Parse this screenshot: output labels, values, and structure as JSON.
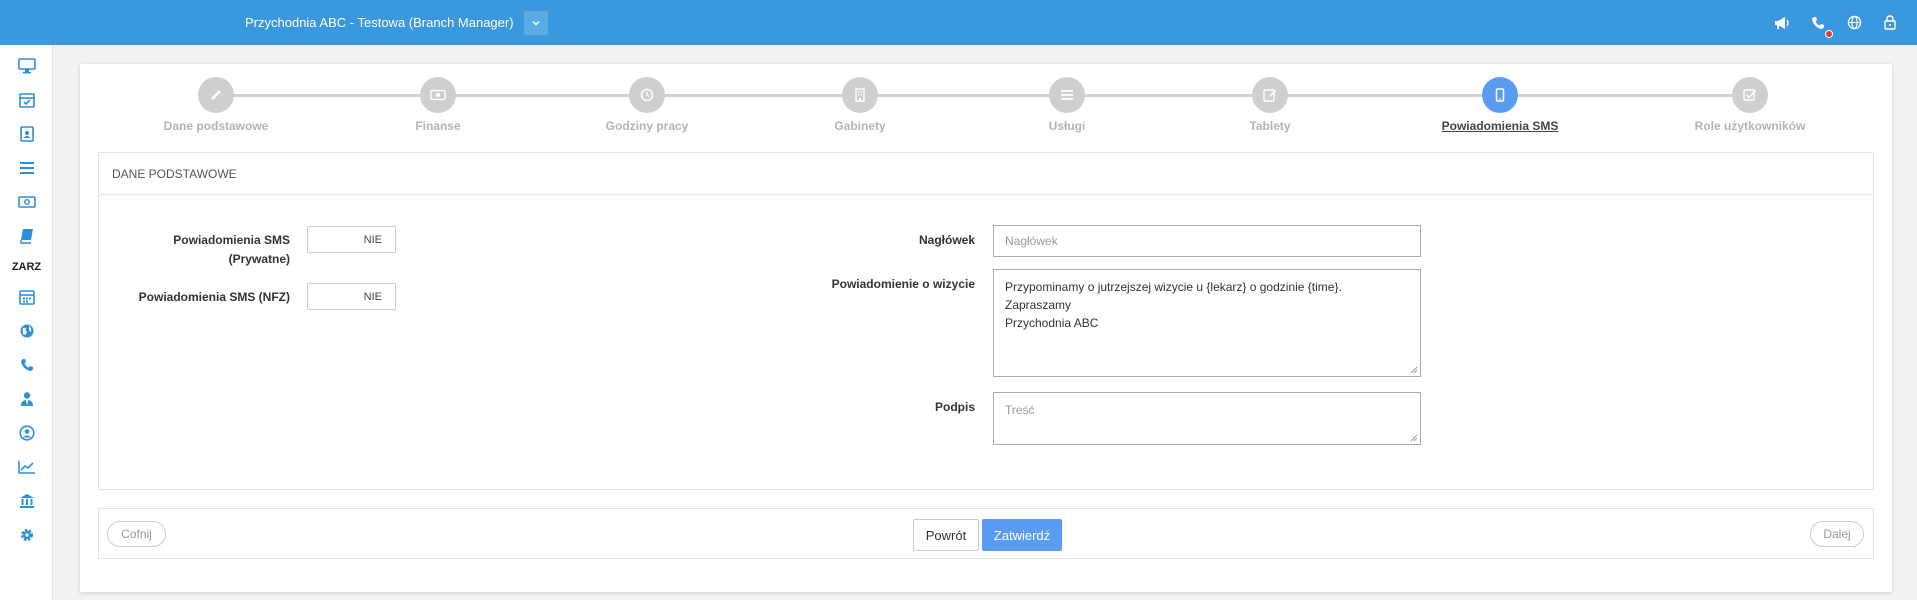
{
  "header": {
    "branch_title": "Przychodnia ABC - Testowa (Branch Manager)"
  },
  "sidebar": {
    "section_label": "ZARZ",
    "items": [
      {
        "icon": "monitor-icon"
      },
      {
        "icon": "calendar-check-icon"
      },
      {
        "icon": "contact-card-icon"
      },
      {
        "icon": "list-icon"
      },
      {
        "icon": "money-icon"
      },
      {
        "icon": "book-icon"
      },
      {
        "icon": "calendar-icon"
      },
      {
        "icon": "globe-icon"
      },
      {
        "icon": "phone-icon"
      },
      {
        "icon": "user-tie-icon"
      },
      {
        "icon": "user-circle-icon"
      },
      {
        "icon": "line-chart-icon"
      },
      {
        "icon": "bank-icon"
      },
      {
        "icon": "gear-icon"
      }
    ]
  },
  "stepper": {
    "active_index": 6,
    "steps": [
      {
        "label": "Dane podstawowe",
        "icon": "pencil-icon"
      },
      {
        "label": "Finanse",
        "icon": "money-icon"
      },
      {
        "label": "Godziny pracy",
        "icon": "clock-icon"
      },
      {
        "label": "Gabinety",
        "icon": "building-icon"
      },
      {
        "label": "Usługi",
        "icon": "list-icon"
      },
      {
        "label": "Tablety",
        "icon": "tablet-edit-icon"
      },
      {
        "label": "Powiadomienia SMS",
        "icon": "mobile-icon"
      },
      {
        "label": "Role użytkowników",
        "icon": "checkbox-icon"
      }
    ]
  },
  "panel": {
    "title": "DANE PODSTAWOWE",
    "sms_private_label_1": "Powiadomienia SMS",
    "sms_private_label_2": "(Prywatne)",
    "sms_private_value": "NIE",
    "sms_nfz_label": "Powiadomienia SMS (NFZ)",
    "sms_nfz_value": "NIE",
    "header_label": "Nagłówek",
    "header_placeholder": "Nagłówek",
    "visit_label": "Powiadomienie o wizycie",
    "visit_text_1": "Przypominamy o jutrzejszej wizycie u {lekarz} o godzinie {time}.",
    "visit_text_2": "Zapraszamy",
    "visit_text_3": "Przychodnia ABC",
    "signature_label": "Podpis",
    "signature_placeholder": "Treść"
  },
  "footer": {
    "back_label": "Cofnij",
    "return_label": "Powrót",
    "confirm_label": "Zatwierdź",
    "next_label": "Dalej"
  },
  "colors": {
    "topbar": "#3a98de",
    "accent": "#5b9cf3",
    "sidebar_icon": "#2f8fd8",
    "step_inactive": "#cfcfcf"
  }
}
